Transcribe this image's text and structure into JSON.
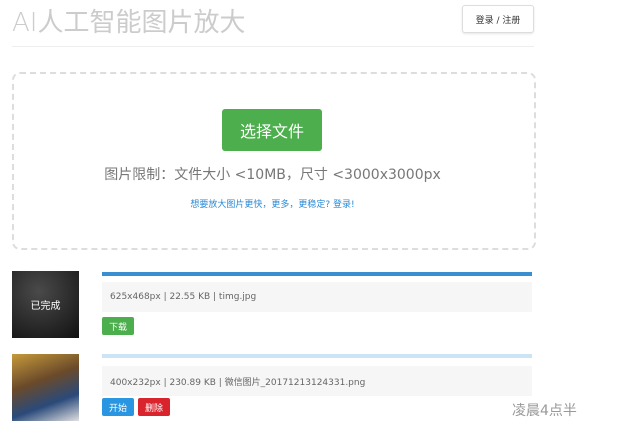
{
  "header": {
    "title": "AI人工智能图片放大",
    "login_label": "登录 / 注册"
  },
  "upload": {
    "choose_label": "选择文件",
    "limit_text": "图片限制：文件大小 <10MB，尺寸 <3000x3000px",
    "login_prompt": "想要放大图片更快，更多，更稳定? 登录!"
  },
  "files": [
    {
      "thumb_status": "已完成",
      "progress": 100,
      "info": "625x468px | 22.55 KB | timg.jpg",
      "download_label": "下载"
    },
    {
      "progress": 0,
      "info": "400x232px | 230.89 KB | 微信图片_20171213124331.png",
      "start_label": "开始",
      "delete_label": "删除"
    }
  ],
  "watermark": "凌晨4点半"
}
